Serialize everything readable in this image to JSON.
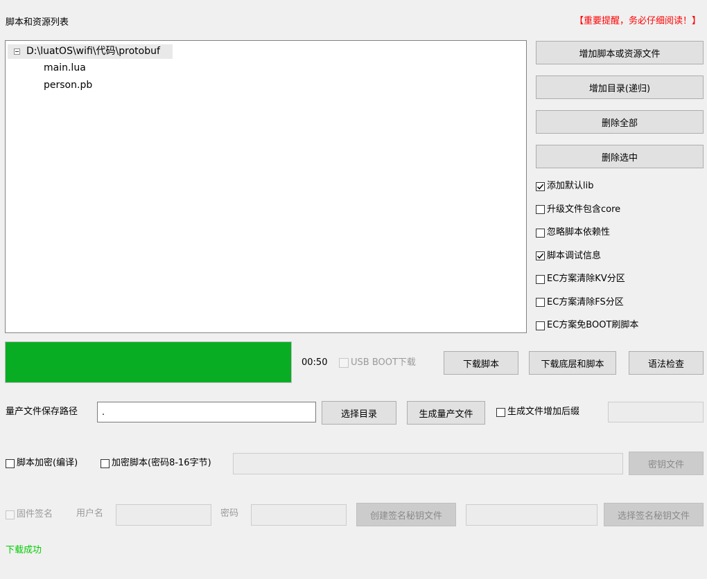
{
  "header": {
    "title": "脚本和资源列表",
    "warning": "【重要提醒，务必仔细阅读！】",
    "warning_color": "#ff0000"
  },
  "tree": {
    "root": "D:\\luatOS\\wifi\\代码\\protobuf",
    "children": [
      "main.lua",
      "person.pb"
    ]
  },
  "side_buttons": {
    "add_file": "增加脚本或资源文件",
    "add_dir": "增加目录(递归)",
    "delete_all": "删除全部",
    "delete_selected": "删除选中"
  },
  "options": [
    {
      "label": "添加默认lib",
      "checked": true
    },
    {
      "label": "升级文件包含core",
      "checked": false
    },
    {
      "label": "忽略脚本依赖性",
      "checked": false
    },
    {
      "label": "脚本调试信息",
      "checked": true
    },
    {
      "label": "EC方案清除KV分区",
      "checked": false
    },
    {
      "label": "EC方案清除FS分区",
      "checked": false
    },
    {
      "label": "EC方案免BOOT刷脚本",
      "checked": false
    }
  ],
  "progress": {
    "value": 1.0,
    "color": "#09ad24",
    "time": "00:50"
  },
  "download": {
    "usb_boot": "USB BOOT下载",
    "download_script": "下载脚本",
    "download_core_script": "下载底层和脚本",
    "syntax_check": "语法检查"
  },
  "production": {
    "path_label": "量产文件保存路径",
    "path_value": ".",
    "choose_dir": "选择目录",
    "generate": "生成量产文件",
    "add_suffix": "生成文件增加后缀",
    "suffix_value": ""
  },
  "encryption": {
    "compile_encrypt": "脚本加密(编译)",
    "encrypt_script": "加密脚本(密码8-16字节)",
    "password_value": "",
    "key_file": "密钥文件"
  },
  "signing": {
    "firmware_sign": "固件签名",
    "username_label": "用户名",
    "username_value": "",
    "password_label": "密码",
    "password_value": "",
    "create_key": "创建签名秘钥文件",
    "key_path_value": "",
    "choose_key": "选择签名秘钥文件"
  },
  "status": {
    "text": "下载成功",
    "color": "#00cc00"
  }
}
